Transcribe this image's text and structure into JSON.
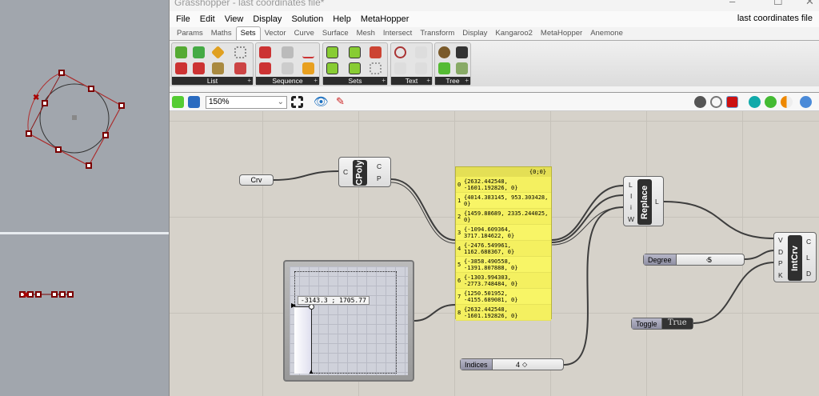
{
  "window": {
    "title": "Grasshopper - last coordinates file*",
    "document_name": "last coordinates file"
  },
  "menu": [
    "File",
    "Edit",
    "View",
    "Display",
    "Solution",
    "Help",
    "MetaHopper"
  ],
  "tabs": [
    "Params",
    "Maths",
    "Sets",
    "Vector",
    "Curve",
    "Surface",
    "Mesh",
    "Intersect",
    "Transform",
    "Display",
    "Kangaroo2",
    "MetaHopper",
    "Anemone"
  ],
  "active_tab": "Sets",
  "ribbon_groups": [
    "List",
    "Sequence",
    "Sets",
    "Text",
    "Tree"
  ],
  "toolbar": {
    "zoom": "150%"
  },
  "nodes": {
    "crv": {
      "label": "Crv"
    },
    "cpoly": {
      "name": "CPoly",
      "inputs": [
        "C"
      ],
      "outputs": [
        "C",
        "P"
      ]
    },
    "panel": {
      "path": "{0;0}",
      "items": [
        {
          "i": "0",
          "v": "{2632.442548, -1601.192826, 0}"
        },
        {
          "i": "1",
          "v": "{4014.383145, 953.303428, 0}"
        },
        {
          "i": "2",
          "v": "{1459.88689, 2335.244025, 0}"
        },
        {
          "i": "3",
          "v": "{-1094.609364, 3717.184622, 0}"
        },
        {
          "i": "4",
          "v": "{-2476.549961, 1162.688367, 0}"
        },
        {
          "i": "5",
          "v": "{-3858.490558, -1391.807888, 0}"
        },
        {
          "i": "6",
          "v": "{-1303.994303, -2773.748484, 0}"
        },
        {
          "i": "7",
          "v": "{1250.501952, -4155.689081, 0}"
        },
        {
          "i": "8",
          "v": "{2632.442548, -1601.192826, 0}"
        }
      ]
    },
    "graph": {
      "readout": "-3143.3 ; 1705.77"
    },
    "replace": {
      "name": "Replace",
      "inputs": [
        "L",
        "I",
        "i",
        "W"
      ],
      "outputs": [
        "L"
      ]
    },
    "intcrv": {
      "name": "IntCrv",
      "inputs": [
        "V",
        "D",
        "P",
        "K"
      ],
      "outputs": [
        "C",
        "L",
        "D"
      ]
    },
    "degree": {
      "label": "Degree",
      "value": "5"
    },
    "toggle": {
      "label": "Toggle",
      "value": "True"
    },
    "indices": {
      "label": "Indices",
      "value": "4"
    }
  }
}
